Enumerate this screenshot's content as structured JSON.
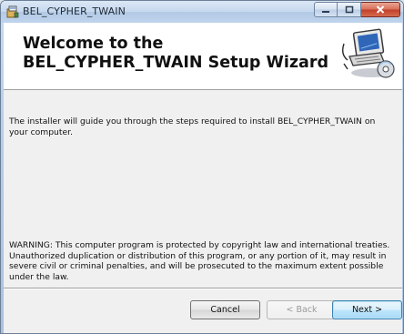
{
  "window": {
    "title": "BEL_CYPHER_TWAIN",
    "icon": "installer-package-icon"
  },
  "title_buttons": {
    "minimize_icon": "minimize-icon",
    "maximize_icon": "maximize-icon",
    "close_icon": "close-icon"
  },
  "banner": {
    "title": "Welcome to the BEL_CYPHER_TWAIN Setup Wizard",
    "art_icon": "computer-install-icon"
  },
  "body": {
    "intro": "The installer will guide you through the steps required to install BEL_CYPHER_TWAIN on your computer.",
    "warning": "WARNING: This computer program is protected by copyright law and international treaties. Unauthorized duplication or distribution of this program, or any portion of it, may result in severe civil or criminal penalties, and will be prosecuted to the maximum extent possible under the law."
  },
  "buttons": {
    "cancel": "Cancel",
    "back": "< Back",
    "next": "Next >"
  },
  "colors": {
    "close_button": "#c2412c",
    "default_button": "#3c7fb1"
  }
}
